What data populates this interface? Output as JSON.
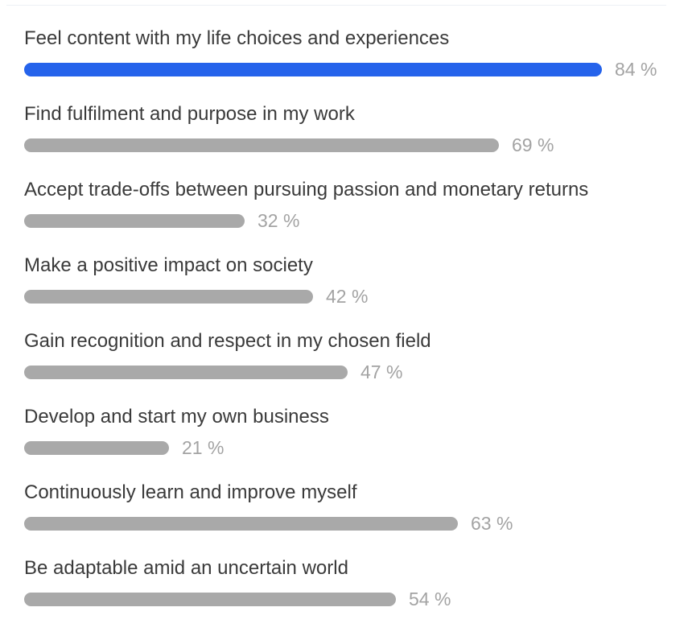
{
  "chart_data": {
    "type": "bar",
    "orientation": "horizontal",
    "unit": "%",
    "categories": [
      "Feel content with my life choices and experiences",
      "Find fulfilment and purpose in my work",
      "Accept trade-offs between pursuing passion and monetary returns",
      "Make a positive impact on society",
      "Gain recognition and respect in my chosen field",
      "Develop and start my own business",
      "Continuously learn and improve myself",
      "Be adaptable amid an uncertain world"
    ],
    "values": [
      84,
      69,
      32,
      42,
      47,
      21,
      63,
      54
    ],
    "value_labels": [
      "84 %",
      "69 %",
      "32 %",
      "42 %",
      "47 %",
      "21 %",
      "63 %",
      "54 %"
    ],
    "highlight_index": 0,
    "colors": {
      "highlight": "#2563eb",
      "default": "#a9a9a9",
      "label": "#3a3a3a",
      "value_label": "#a3a3a3"
    },
    "xlim": [
      0,
      100
    ],
    "grid": false,
    "legend": "none"
  }
}
